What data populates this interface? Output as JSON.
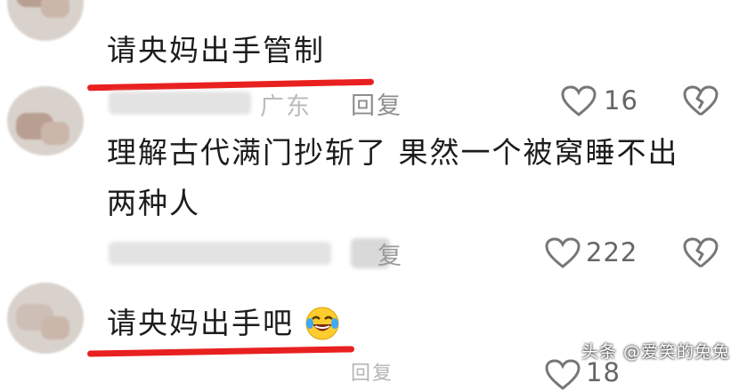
{
  "comments": [
    {
      "text": "请央妈出手管制",
      "location_partial": "广东",
      "reply": "回复",
      "likes": "16"
    },
    {
      "text_line1": "理解古代满门抄斩了 果然一个被窝睡不出",
      "text_line2": "两种人",
      "reply_partial": "复",
      "likes": "222"
    },
    {
      "text": "请央妈出手吧",
      "emoji": "laughing-crying-emoji",
      "likes_partial": "18"
    }
  ],
  "watermark": "头条 @爱笑的兔兔",
  "colors": {
    "underline": "#e8201f",
    "meta_gray": "#8e8e8e",
    "text": "#1c1c1c"
  },
  "icons": [
    "heart-outline-icon",
    "broken-heart-icon"
  ]
}
